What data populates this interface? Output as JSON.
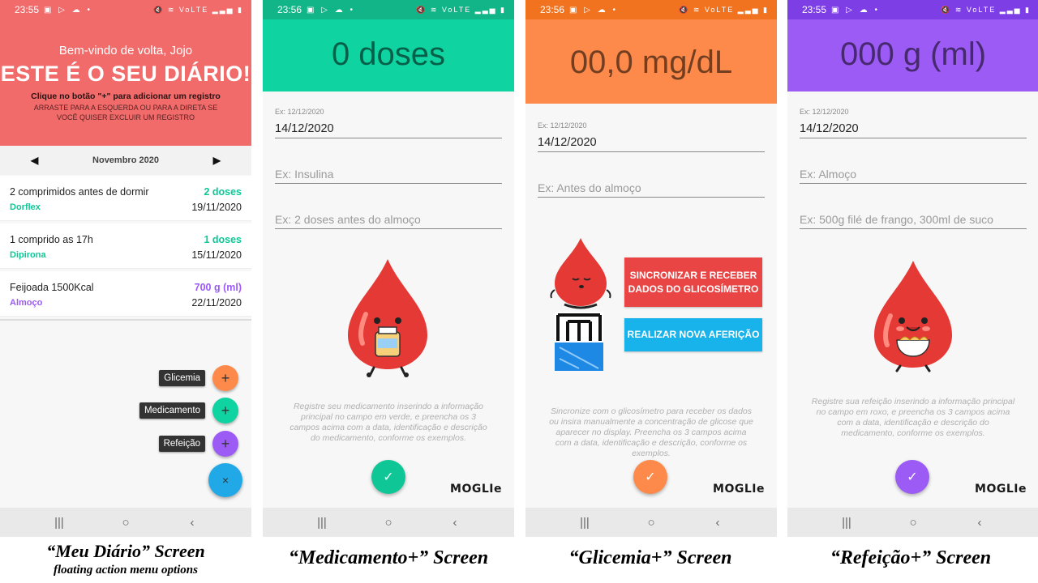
{
  "colors": {
    "diary_red": "#f16b6b",
    "medication_green": "#0fd3a0",
    "glucose_orange": "#fd8a4a",
    "meal_purple": "#9c5bf5",
    "fab_blue": "#20a9e6",
    "sync_red": "#e94545",
    "measure_blue": "#18b3ea"
  },
  "status_bar": {
    "s1_time": "23:55",
    "s2_time": "23:56",
    "s3_time": "23:56",
    "s4_time": "23:55",
    "left_icons": "▣ ▷ ☁ •",
    "right_icons": "🔇 ≋ VoLTE ▂▃▅ ▮"
  },
  "nav": {
    "recents": "|||",
    "home": "○",
    "back": "‹"
  },
  "screen1": {
    "welcome": "Bem-vindo de volta, Jojo",
    "title": "ESTE É O SEU DIÁRIO!",
    "hint": "Clique no botão \"+\" para adicionar um registro",
    "hint2": "ARRASTE PARA A ESQUERDA OU PARA A DIRETA SE VOCÊ QUISER EXCLUIR UM REGISTRO",
    "month": "Novembro 2020",
    "prev": "◀",
    "next": "▶",
    "entries": [
      {
        "description": "2 comprimidos antes de dormir",
        "name": "Dorflex",
        "amount": "2 doses",
        "date": "19/11/2020"
      },
      {
        "description": "1 comprido as 17h",
        "name": "Dipirona",
        "amount": "1 doses",
        "date": "15/11/2020"
      },
      {
        "description": "Feijoada 1500Kcal",
        "name": "Almoço",
        "amount": "700 g (ml)",
        "date": "22/11/2020"
      }
    ],
    "fab_menu": [
      {
        "label": "Glicemia",
        "icon": "+"
      },
      {
        "label": "Medicamento",
        "icon": "+"
      },
      {
        "label": "Refeição",
        "icon": "+"
      }
    ],
    "main_fab_icon": "×",
    "caption": "“Meu Diário” Screen",
    "caption_sub": "floating action menu options"
  },
  "screen2": {
    "header_value": "0 doses",
    "date_hint": "Ex: 12/12/2020",
    "date_value": "14/12/2020",
    "name_placeholder": "Ex: Insulina",
    "desc_placeholder": "Ex: 2 doses antes do almoço",
    "description": "Registre seu medicamento inserindo a informação principal no campo em verde, e preencha os 3 campos acima com a data, identificação e descrição do medicamento, conforme os exemplos.",
    "confirm_icon": "✓",
    "brand": "MOGLIe",
    "caption": "“Medicamento+” Screen"
  },
  "screen3": {
    "header_value": "00,0 mg/dL",
    "date_hint": "Ex: 12/12/2020",
    "date_value": "14/12/2020",
    "name_placeholder": "Ex: Antes do almoço",
    "sync_button": "SINCRONIZAR E RECEBER DADOS DO GLICOSÍMETRO",
    "measure_button": "REALIZAR NOVA AFERIÇÃO",
    "description": "Sincronize com o glicosímetro para receber os dados ou insira manualmente a concentração de glicose que aparecer no display. Preencha os 3 campos acima com a data, identificação e descrição, conforme os exemplos.",
    "confirm_icon": "✓",
    "brand": "MOGLIe",
    "caption": "“Glicemia+” Screen"
  },
  "screen4": {
    "header_value": "000 g (ml)",
    "date_hint": "Ex: 12/12/2020",
    "date_value": "14/12/2020",
    "name_placeholder": "Ex: Almoço",
    "desc_placeholder": "Ex: 500g filé de frango, 300ml de suco",
    "description": "Registre sua refeição inserindo a informação principal no campo em roxo, e preencha os 3 campos acima com a data, identificação e descrição do medicamento, conforme os exemplos.",
    "confirm_icon": "✓",
    "brand": "MOGLIe",
    "caption": "“Refeição+” Screen"
  }
}
